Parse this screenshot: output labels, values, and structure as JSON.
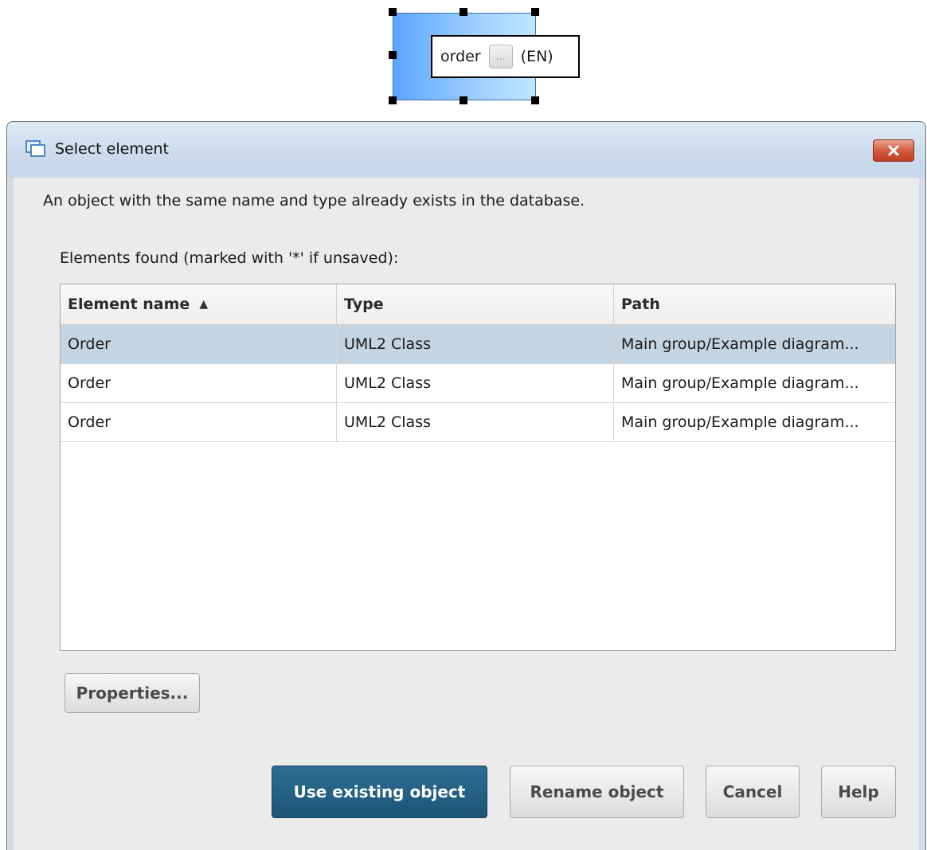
{
  "diagram": {
    "element_label": "order",
    "language": "(EN)",
    "ellipsis_button": "..."
  },
  "dialog": {
    "title": "Select element",
    "close_icon": "close-x-icon",
    "message": "An object with the same name and type already exists in the database.",
    "found_label": "Elements found (marked with '*' if unsaved):",
    "columns": [
      "Element name",
      "Type",
      "Path"
    ],
    "sort_indicator": "ascending",
    "rows": [
      {
        "name": "Order",
        "type": "UML2 Class",
        "path": "Main group/Example diagram..."
      },
      {
        "name": "Order",
        "type": "UML2 Class",
        "path": "Main group/Example diagram..."
      },
      {
        "name": "Order",
        "type": "UML2 Class",
        "path": "Main group/Example diagram..."
      }
    ],
    "selected_row": 0,
    "buttons": {
      "properties": "Properties...",
      "use_existing": "Use existing object",
      "rename": "Rename object",
      "cancel": "Cancel",
      "help": "Help"
    }
  },
  "colors": {
    "primary_button": "#1f5b80",
    "selected_row": "#c3d4e2",
    "close_button": "#c94a2d"
  }
}
